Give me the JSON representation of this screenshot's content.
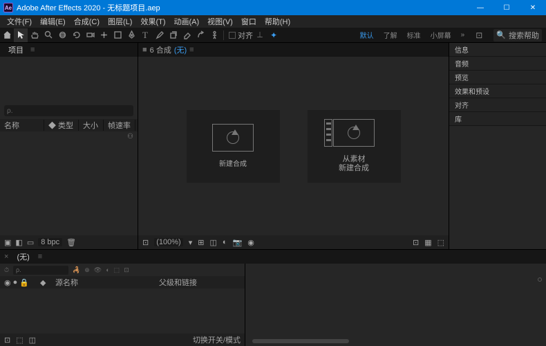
{
  "titlebar": {
    "app_abbr": "Ae",
    "title": "Adobe After Effects 2020 - 无标题项目.aep"
  },
  "menu": [
    "文件(F)",
    "编辑(E)",
    "合成(C)",
    "图层(L)",
    "效果(T)",
    "动画(A)",
    "视图(V)",
    "窗口",
    "帮助(H)"
  ],
  "toolbar": {
    "snap_label": "对齐",
    "workspaces": [
      "默认",
      "了解",
      "标准",
      "小屏幕"
    ],
    "active_ws_index": 0,
    "search_placeholder": "搜索帮助"
  },
  "project": {
    "tab": "项目",
    "search_placeholder": "ρ.",
    "columns": {
      "name": "名称",
      "tags": "◆ 类型",
      "size": "大小",
      "fr": "帧速率"
    },
    "footer": {
      "bpc": "8 bpc"
    }
  },
  "composition": {
    "tab_prefix": "6 合成",
    "tab_active": "(无)",
    "card1": "新建合成",
    "card2_l1": "从素材",
    "card2_l2": "新建合成",
    "zoom": "(100%)"
  },
  "right_panels": [
    "信息",
    "音频",
    "预览",
    "效果和预设",
    "对齐",
    "库"
  ],
  "timeline": {
    "tab": "(无)",
    "search_placeholder": "ρ.",
    "header": {
      "layer": "源名称",
      "parent": "父级和链接"
    },
    "footer": "切换开关/模式"
  },
  "colors": {
    "win_accent": "#0078d7",
    "blue": "#3a9cf0",
    "bg": "#232323"
  }
}
